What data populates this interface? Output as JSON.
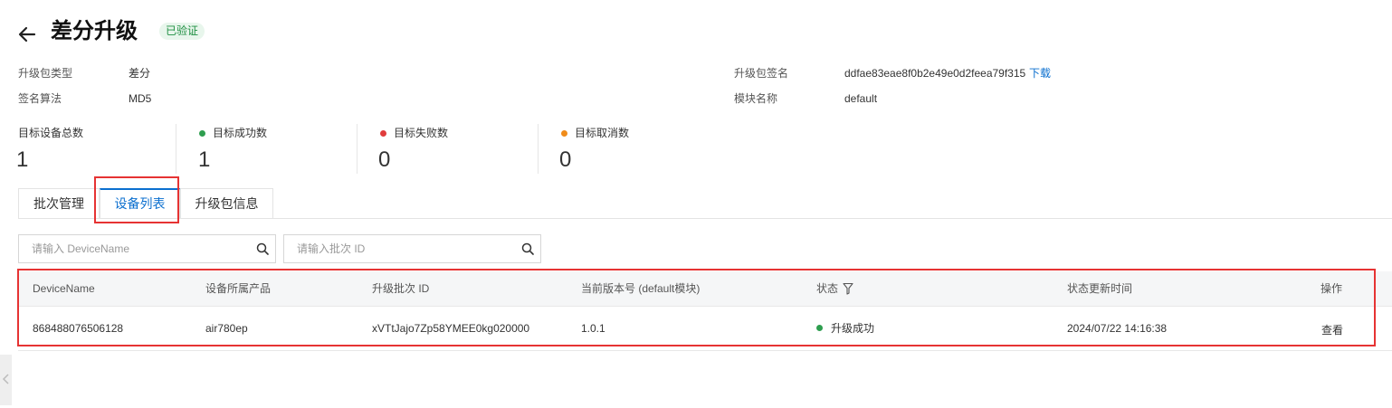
{
  "header": {
    "title": "差分升级",
    "badge": "已验证"
  },
  "meta": {
    "left": [
      {
        "label": "升级包类型",
        "value": "差分"
      },
      {
        "label": "签名算法",
        "value": "MD5"
      }
    ],
    "right": [
      {
        "label": "升级包签名",
        "value": "ddfae83eae8f0b2e49e0d2feea79f315",
        "link": "下载"
      },
      {
        "label": "模块名称",
        "value": "default"
      }
    ]
  },
  "stats": [
    {
      "label": "目标设备总数",
      "value": "1",
      "dot": ""
    },
    {
      "label": "目标成功数",
      "value": "1",
      "dot": "#2e9e4f"
    },
    {
      "label": "目标失败数",
      "value": "0",
      "dot": "#e03c3c"
    },
    {
      "label": "目标取消数",
      "value": "0",
      "dot": "#f08c1a"
    }
  ],
  "tabs": [
    {
      "label": "批次管理"
    },
    {
      "label": "设备列表",
      "active": true
    },
    {
      "label": "升级包信息"
    }
  ],
  "search": {
    "device_placeholder": "请输入 DeviceName",
    "batch_placeholder": "请输入批次 ID"
  },
  "table": {
    "columns": [
      "DeviceName",
      "设备所属产品",
      "升级批次 ID",
      "当前版本号 (default模块)",
      "状态",
      "状态更新时间",
      "操作"
    ],
    "rows": [
      {
        "device_name": "868488076506128",
        "product": "air780ep",
        "batch_id": "xVTtJajo7Zp58YMEE0kg020000",
        "version": "1.0.1",
        "status": "升级成功",
        "updated": "2024/07/22 14:16:38",
        "action": "查看"
      }
    ]
  },
  "colors": {
    "accent": "#0b6fcf",
    "success": "#2e9e4f",
    "fail": "#e03c3c",
    "cancel": "#f08c1a",
    "highlight": "#e63333"
  },
  "icons": [
    "arrow-left-icon",
    "search-icon",
    "filter-icon",
    "chevron-left-icon"
  ]
}
